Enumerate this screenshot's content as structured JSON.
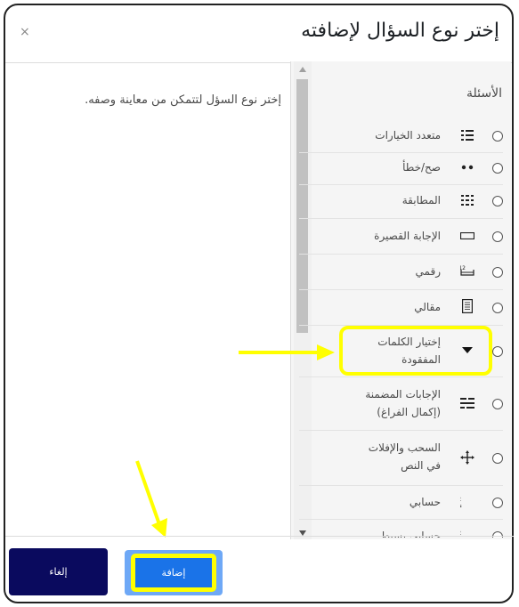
{
  "dialog": {
    "title": "إختر نوع السؤال لإضافته",
    "close_label": "×",
    "description": "إختر نوع السؤل لتتمكن من معاينة وصفه.",
    "group_label": "الأسئلة",
    "options": [
      {
        "label": "متعدد الخيارات",
        "icon": "list-icon"
      },
      {
        "label": "صح/خطأ",
        "icon": "dots-icon"
      },
      {
        "label": "المطابقة",
        "icon": "match-list-icon"
      },
      {
        "label": "الإجابة القصيرة",
        "icon": "short-answer-icon"
      },
      {
        "label": "رقمي",
        "icon": "numeric-icon"
      },
      {
        "label": "مقالي",
        "icon": "essay-icon"
      },
      {
        "label": "إختيار الكلمات المفقودة",
        "icon": "dropdown-caret-icon"
      },
      {
        "label": "الإجابات المضمنة (إكمال الفراغ)",
        "icon": "cloze-icon"
      },
      {
        "label": "السحب والإفلات في النص",
        "icon": "drag-move-icon"
      },
      {
        "label": "حسابي",
        "icon": "calculated-icon"
      },
      {
        "label": "حسابي بسيط",
        "icon": "calculated-simple-icon"
      }
    ],
    "buttons": {
      "add": "إضافة",
      "cancel": "إلغاء"
    }
  },
  "colors": {
    "highlight": "#ffff00",
    "primary": "#1a73e8",
    "cancel": "#0a0a5e"
  }
}
